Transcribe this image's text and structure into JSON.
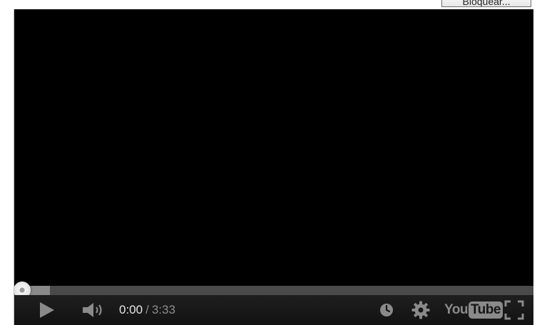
{
  "page": {
    "block_button_label": "Bloquear..."
  },
  "player": {
    "progress": {
      "played_fraction": 0.0,
      "loaded_fraction": 0.07
    },
    "time": {
      "current": "0:00",
      "separator": "/",
      "duration": "3:33"
    },
    "icons": {
      "play": "play-icon",
      "volume": "volume-icon",
      "watch_later": "clock-icon",
      "settings": "gear-icon",
      "fullscreen": "fullscreen-icon"
    },
    "logo": {
      "you": "You",
      "tube": "Tube"
    },
    "colors": {
      "background": "#000000",
      "controls": "#1a1a1a",
      "icon": "#8a8a8a",
      "time_current": "#e8e8e8"
    }
  }
}
